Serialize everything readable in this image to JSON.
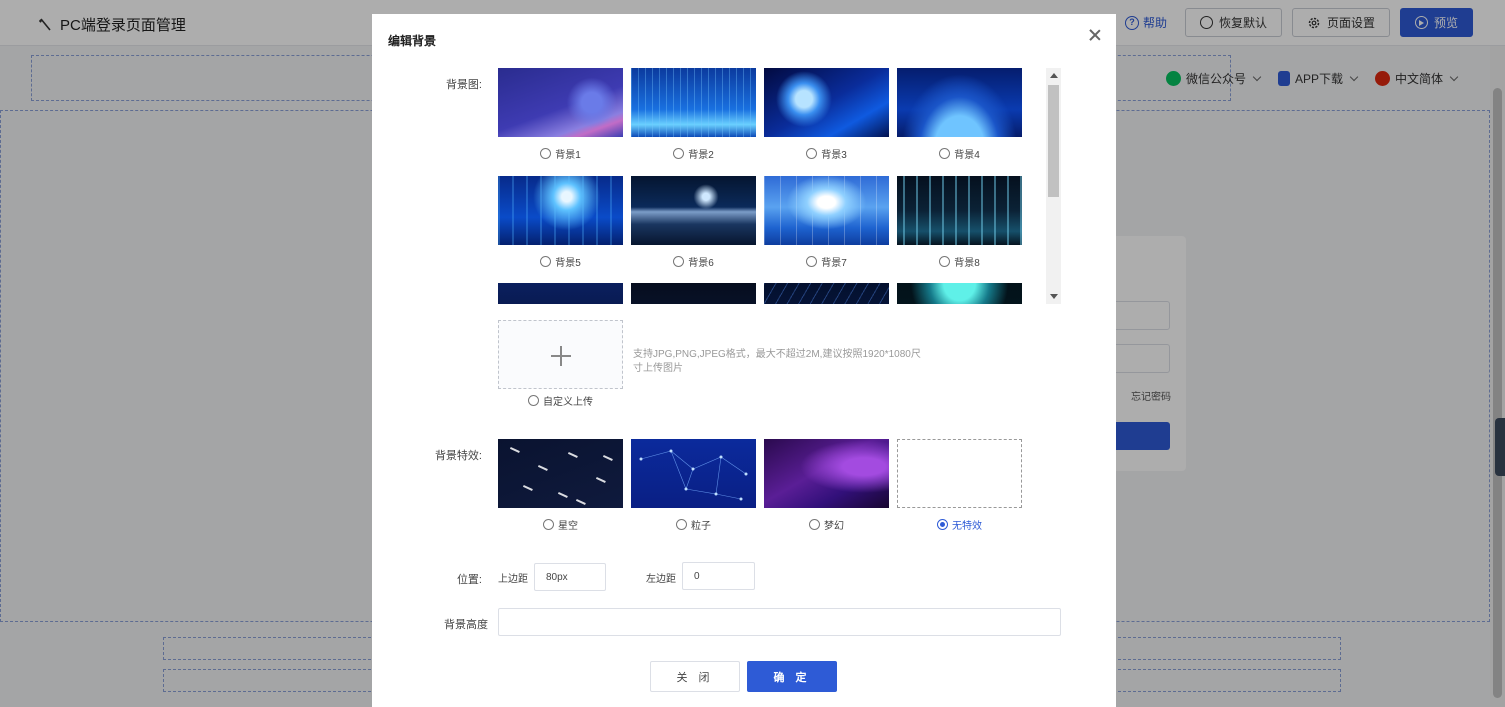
{
  "app": {
    "title": "PC端登录页面管理",
    "help": "帮助",
    "restore_default": "恢复默认",
    "page_settings": "页面设置",
    "preview": "预览"
  },
  "header_links": [
    {
      "label": "微信公众号",
      "icon": "wechat-icon",
      "color": "#07c160"
    },
    {
      "label": "APP下载",
      "icon": "phone-icon",
      "color": "#2e5bd6"
    },
    {
      "label": "中文简体",
      "icon": "china-flag-icon",
      "color": "#de2910"
    }
  ],
  "login_card": {
    "forgot_password": "忘记密码"
  },
  "modal": {
    "title": "编辑背景",
    "bg_image_label": "背景图:",
    "backgrounds": [
      {
        "label": "背景1",
        "selected": false
      },
      {
        "label": "背景2",
        "selected": false
      },
      {
        "label": "背景3",
        "selected": false
      },
      {
        "label": "背景4",
        "selected": false
      },
      {
        "label": "背景5",
        "selected": false
      },
      {
        "label": "背景6",
        "selected": false
      },
      {
        "label": "背景7",
        "selected": false
      },
      {
        "label": "背景8",
        "selected": false
      }
    ],
    "upload_hint": "支持JPG,PNG,JPEG格式，最大不超过2M,建议按照1920*1080尺寸上传图片",
    "custom_upload_label": "自定义上传",
    "effects_label": "背景特效:",
    "effects": [
      {
        "label": "星空",
        "selected": false
      },
      {
        "label": "粒子",
        "selected": false
      },
      {
        "label": "梦幻",
        "selected": false
      },
      {
        "label": "无特效",
        "selected": true
      }
    ],
    "position_label": "位置:",
    "top_margin_label": "上边距",
    "top_margin_value": "80px",
    "left_margin_label": "左边距",
    "left_margin_value": "0",
    "bg_height_label": "背景高度",
    "bg_height_value": "",
    "close_button": "关 闭",
    "confirm_button": "确 定"
  },
  "colors": {
    "primary": "#2e5bd6",
    "overlay": "rgba(0,0,0,0.32)"
  }
}
